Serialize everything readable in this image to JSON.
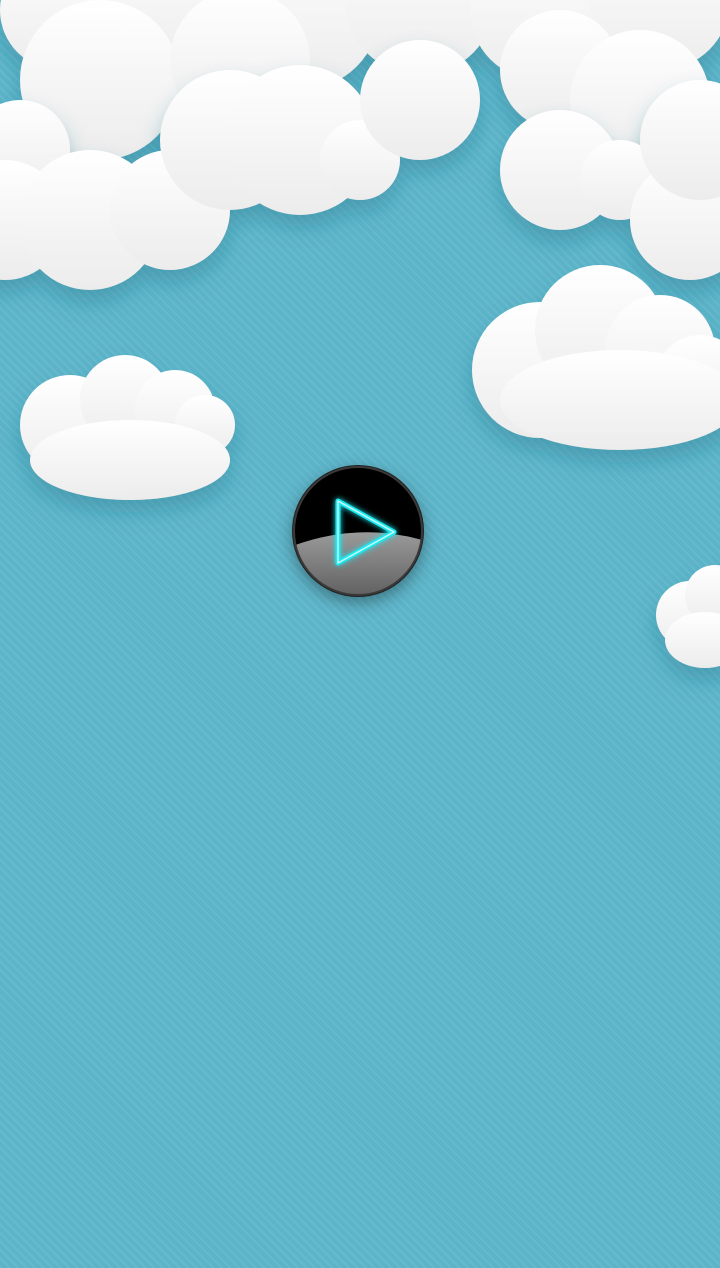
{
  "screen": {
    "name": "start-screen",
    "background_color": "#5cb4c9"
  },
  "play_button": {
    "icon": "play-icon",
    "accent_color": "#1de9f0",
    "face_color": "#000000",
    "lower_color": "#7a7a7a"
  },
  "clouds": {
    "color": "#ffffff",
    "shadow_color": "#d9d9d9"
  }
}
